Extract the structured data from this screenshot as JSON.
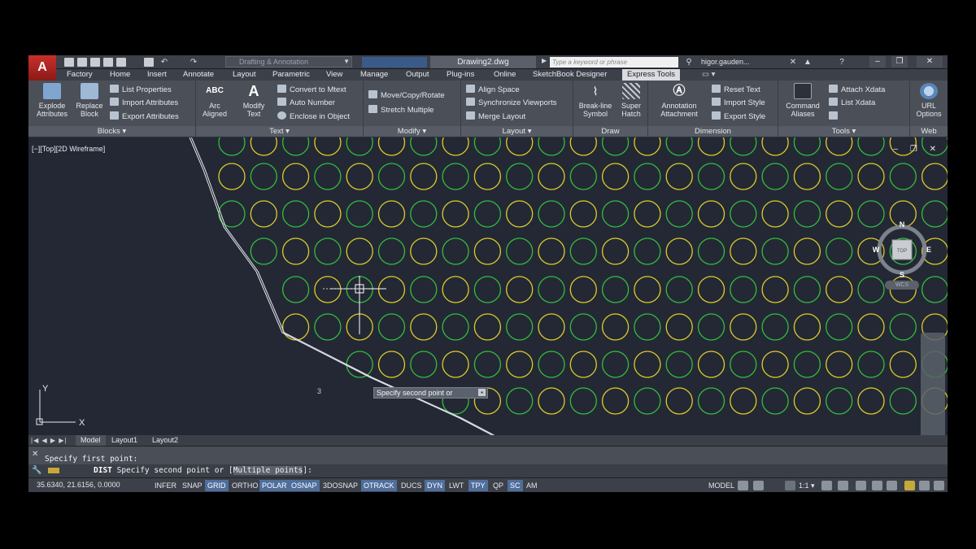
{
  "app": {
    "logo": "A",
    "document_title": "Drawing2.dwg",
    "workspace": "Drafting & Annotation",
    "search_placeholder": "Type a keyword or phrase",
    "user": "higor.gauden...",
    "blurred_tab": "  "
  },
  "window_controls": {
    "minimize": "–",
    "restore": "❐",
    "close": "✕"
  },
  "menu_tabs": [
    "Factory",
    "Home",
    "Insert",
    "Annotate",
    "Layout",
    "Parametric",
    "View",
    "Manage",
    "Output",
    "Plug-ins",
    "Online",
    "SketchBook Designer",
    "Express Tools"
  ],
  "active_tab": "Express Tools",
  "ribbon": {
    "blocks": {
      "title": "Blocks ▾",
      "explode": "Explode\nAttributes",
      "explode_l1": "Explode",
      "explode_l2": "Attributes",
      "replace_l1": "Replace",
      "replace_l2": "Block",
      "list_properties": "List Properties",
      "import_attributes": "Import Attributes",
      "export_attributes": "Export Attributes"
    },
    "text": {
      "title": "Text ▾",
      "arc_l1": "Arc",
      "arc_l2": "Aligned",
      "modify_l1": "Modify",
      "modify_l2": "Text",
      "convert": "Convert to Mtext",
      "auto_number": "Auto Number",
      "enclose": "Enclose in Object",
      "abc": "ABC"
    },
    "modify": {
      "title": "Modify ▾",
      "move": "Move/Copy/Rotate",
      "stretch": "Stretch Multiple"
    },
    "layout": {
      "title": "Layout ▾",
      "align": "Align Space",
      "sync": "Synchronize Viewports",
      "merge": "Merge Layout"
    },
    "draw": {
      "title": "Draw",
      "breakline_l1": "Break-line",
      "breakline_l2": "Symbol",
      "super_l1": "Super",
      "super_l2": "Hatch"
    },
    "dimension": {
      "title": "Dimension",
      "annot_l1": "Annotation",
      "annot_l2": "Attachment",
      "reset": "Reset Text",
      "import_style": "Import Style",
      "export_style": "Export Style"
    },
    "tools": {
      "title": "Tools ▾",
      "cmd_l1": "Command",
      "cmd_l2": "Aliases",
      "attach": "Attach Xdata",
      "list": "List Xdata"
    },
    "web": {
      "title": "Web",
      "url_l1": "URL",
      "url_l2": "Options"
    }
  },
  "viewport": {
    "label": "[−][Top][2D Wireframe]",
    "controls": "– ❐ ✕"
  },
  "viewcube": {
    "n": "N",
    "s": "S",
    "e": "E",
    "w": "W",
    "top": "TOP",
    "wcs": "WCS"
  },
  "ucs": {
    "x": "X",
    "y": "Y"
  },
  "tooltip": {
    "text": "Specify second point or",
    "btn": "▪"
  },
  "dimension_label": "3",
  "layout_tabs": {
    "nav": "|◀ ◀ ▶ ▶|",
    "model": "Model",
    "layout1": "Layout1",
    "layout2": "Layout2"
  },
  "command": {
    "history": "Specify first point:",
    "prefix": "DIST",
    "prompt": " Specify second point or [",
    "option": "Multiple points",
    "suffix": "]:"
  },
  "status": {
    "coords": "35.6340, 21.6156, 0.0000",
    "toggles": [
      {
        "label": "INFER",
        "on": false
      },
      {
        "label": "SNAP",
        "on": false
      },
      {
        "label": "GRID",
        "on": true
      },
      {
        "label": "ORTHO",
        "on": false
      },
      {
        "label": "POLAR",
        "on": true
      },
      {
        "label": "OSNAP",
        "on": true
      },
      {
        "label": "3DOSNAP",
        "on": false
      },
      {
        "label": "OTRACK",
        "on": true
      },
      {
        "label": "DUCS",
        "on": false
      },
      {
        "label": "DYN",
        "on": true
      },
      {
        "label": "LWT",
        "on": false
      },
      {
        "label": "TPY",
        "on": true
      },
      {
        "label": "QP",
        "on": false
      },
      {
        "label": "SC",
        "on": true
      },
      {
        "label": "AM",
        "on": false
      }
    ],
    "model": "MODEL",
    "scale": "1:1 ▾"
  },
  "colors": {
    "grid_green": "#2fbf3f",
    "grid_yellow": "#d9cf2a",
    "accent": "#4f6e9c"
  }
}
